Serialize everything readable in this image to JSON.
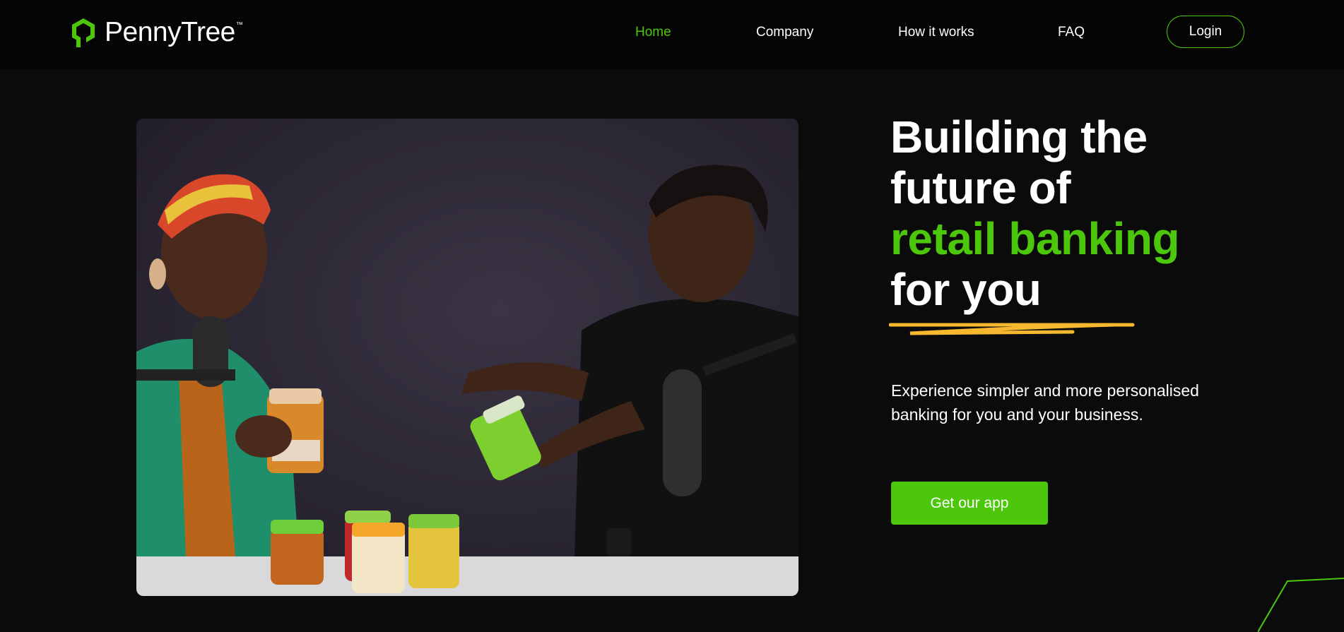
{
  "brand": {
    "name": "PennyTree",
    "trademark": "™",
    "logo_icon": "pennytree-logo-icon"
  },
  "nav": {
    "items": [
      {
        "label": "Home",
        "active": true
      },
      {
        "label": "Company",
        "active": false
      },
      {
        "label": "How it works",
        "active": false
      },
      {
        "label": "FAQ",
        "active": false
      }
    ],
    "login_label": "Login"
  },
  "hero": {
    "title_lines": [
      "Building the",
      "future of",
      "retail banking",
      "for you"
    ],
    "subtitle": "Experience simpler and more personalised banking for you and your business.",
    "cta_label": "Get our app"
  },
  "colors": {
    "background": "#0b0b0b",
    "nav_background": "#050505",
    "accent_green": "#4cc70c",
    "scribble_yellow": "#f5b82e"
  }
}
